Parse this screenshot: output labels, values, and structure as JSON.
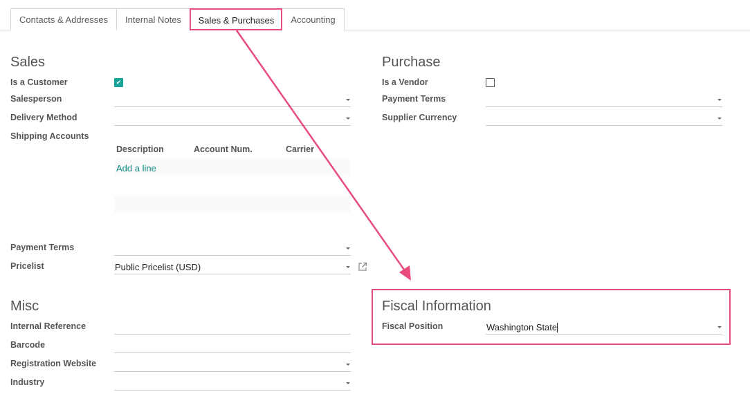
{
  "tabs": [
    {
      "label": "Contacts & Addresses",
      "active": false
    },
    {
      "label": "Internal Notes",
      "active": false
    },
    {
      "label": "Sales & Purchases",
      "active": true
    },
    {
      "label": "Accounting",
      "active": false
    }
  ],
  "sales": {
    "title": "Sales",
    "is_customer_label": "Is a Customer",
    "is_customer": true,
    "salesperson_label": "Salesperson",
    "salesperson_value": "",
    "delivery_method_label": "Delivery Method",
    "delivery_method_value": "",
    "shipping_accounts_label": "Shipping Accounts",
    "shipping_table": {
      "columns": [
        "Description",
        "Account Num.",
        "Carrier"
      ],
      "add_line": "Add a line"
    },
    "payment_terms_label": "Payment Terms",
    "payment_terms_value": "",
    "pricelist_label": "Pricelist",
    "pricelist_value": "Public Pricelist (USD)"
  },
  "purchase": {
    "title": "Purchase",
    "is_vendor_label": "Is a Vendor",
    "is_vendor": false,
    "payment_terms_label": "Payment Terms",
    "payment_terms_value": "",
    "supplier_currency_label": "Supplier Currency",
    "supplier_currency_value": ""
  },
  "misc": {
    "title": "Misc",
    "internal_reference_label": "Internal Reference",
    "internal_reference_value": "",
    "barcode_label": "Barcode",
    "barcode_value": "",
    "registration_website_label": "Registration Website",
    "registration_website_value": "",
    "industry_label": "Industry",
    "industry_value": ""
  },
  "fiscal": {
    "title": "Fiscal Information",
    "fiscal_position_label": "Fiscal Position",
    "fiscal_position_value": "Washington State"
  },
  "annotation": {
    "color": "#e74c7c"
  }
}
